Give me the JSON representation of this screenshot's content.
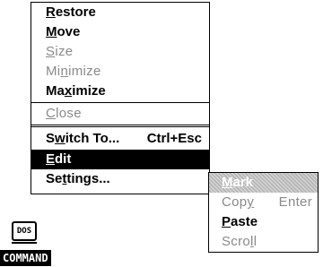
{
  "system_menu": {
    "restore": {
      "pre": "",
      "key": "R",
      "post": "estore"
    },
    "move": {
      "pre": "",
      "key": "M",
      "post": "ove"
    },
    "size": {
      "pre": "",
      "key": "S",
      "post": "ize"
    },
    "minimize": {
      "pre": "Mi",
      "key": "n",
      "post": "imize"
    },
    "maximize": {
      "pre": "Ma",
      "key": "x",
      "post": "imize"
    },
    "close": {
      "pre": "",
      "key": "C",
      "post": "lose"
    },
    "switch_to": {
      "pre": "S",
      "key": "w",
      "post": "itch To...",
      "shortcut": "Ctrl+Esc"
    },
    "edit": {
      "pre": "",
      "key": "E",
      "post": "dit"
    },
    "settings": {
      "pre": "Se",
      "key": "t",
      "post": "tings..."
    }
  },
  "edit_submenu": {
    "mark": {
      "pre": "",
      "key": "M",
      "post": "ark"
    },
    "copy": {
      "pre": "Cop",
      "key": "y",
      "post": "",
      "shortcut": "Enter"
    },
    "paste": {
      "pre": "",
      "key": "P",
      "post": "aste"
    },
    "scroll": {
      "pre": "Scro",
      "key": "l",
      "post": "l"
    }
  },
  "desktop_icon": {
    "glyph": "DOS",
    "label": "COMMAND"
  }
}
